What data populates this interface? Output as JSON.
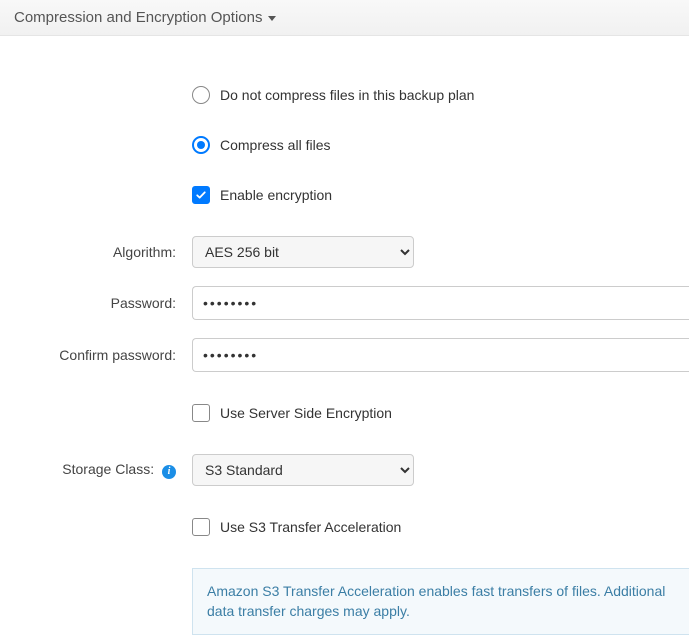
{
  "section": {
    "title": "Compression and Encryption Options"
  },
  "options": {
    "do_not_compress": {
      "label": "Do not compress files in this backup plan",
      "selected": false
    },
    "compress_all": {
      "label": "Compress all files",
      "selected": true
    },
    "enable_encryption": {
      "label": "Enable encryption",
      "checked": true
    }
  },
  "algorithm": {
    "label": "Algorithm:",
    "value": "AES 256 bit"
  },
  "password": {
    "label": "Password:",
    "value": "••••••••"
  },
  "confirm": {
    "label": "Confirm password:",
    "value": "••••••••"
  },
  "sse": {
    "label": "Use Server Side Encryption",
    "checked": false
  },
  "storage_class": {
    "label": "Storage Class:",
    "value": "S3 Standard"
  },
  "transfer_accel": {
    "label": "Use S3 Transfer Acceleration",
    "checked": false
  },
  "notice": {
    "text": "Amazon S3 Transfer Acceleration enables fast transfers of files. Additional data transfer charges may apply."
  }
}
